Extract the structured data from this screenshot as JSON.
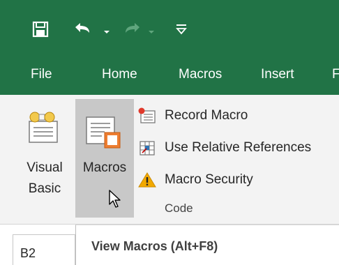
{
  "quick_access": {
    "save_icon": "save-icon",
    "undo_icon": "undo-icon",
    "redo_icon": "redo-icon",
    "customize_icon": "customize-toolbar-icon"
  },
  "tabs": [
    {
      "label": "File"
    },
    {
      "label": "Home"
    },
    {
      "label": "Macros"
    },
    {
      "label": "Insert"
    },
    {
      "label": "F"
    }
  ],
  "ribbon": {
    "visual_basic": {
      "line1": "Visual",
      "line2": "Basic",
      "icon": "visual-basic-icon"
    },
    "macros": {
      "label": "Macros",
      "icon": "macros-icon",
      "state": "hovered"
    },
    "record_macro": {
      "label": "Record Macro",
      "icon": "record-macro-icon"
    },
    "relative_refs": {
      "label": "Use Relative References",
      "icon": "relative-references-icon"
    },
    "macro_security": {
      "label": "Macro Security",
      "icon": "warning-icon"
    },
    "group_label": "Code"
  },
  "name_box": {
    "value": "B2"
  },
  "tooltip": {
    "title": "View Macros (Alt+F8)"
  },
  "colors": {
    "accent": "#217346",
    "ribbon_bg": "#f3f3f3",
    "hover_bg": "#c8c8c8",
    "warning": "#f2a900",
    "record_red": "#e0392b"
  }
}
